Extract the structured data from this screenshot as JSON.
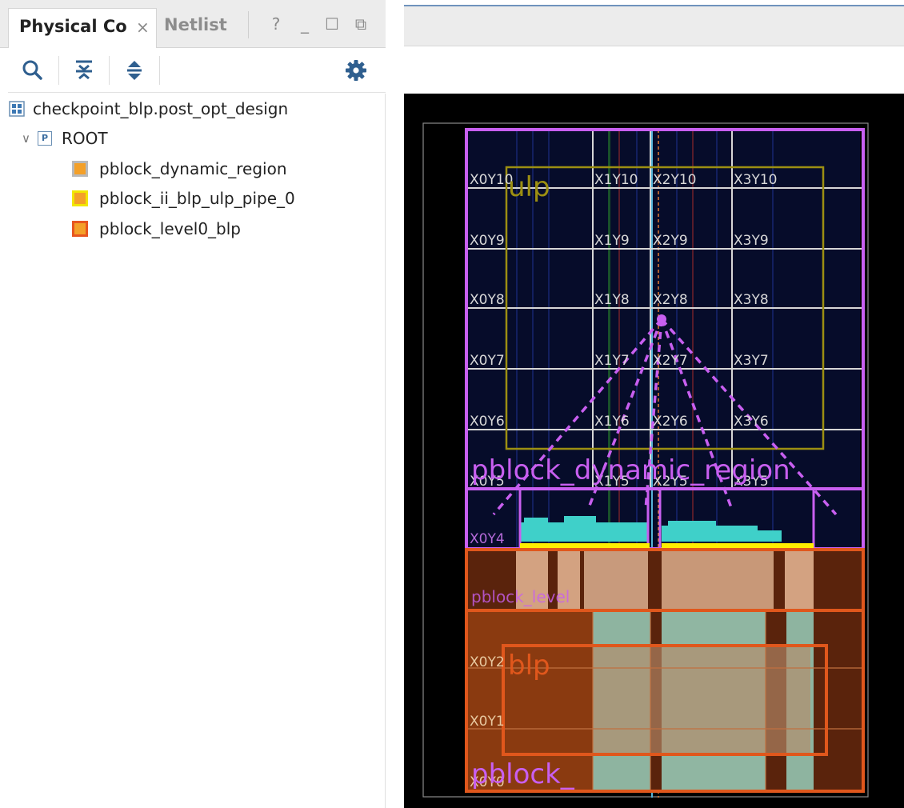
{
  "tabs": {
    "physical_constraints": "Physical Co",
    "netlist": "Netlist",
    "close_symbol": "×"
  },
  "window_controls": {
    "help": "?",
    "minimize": "_",
    "maximize": "☐",
    "float": "⧉"
  },
  "toolbar": {
    "icons": [
      "search-icon",
      "collapse-all-icon",
      "expand-all-icon",
      "settings-gear-icon"
    ]
  },
  "tree": {
    "design": "checkpoint_blp.post_opt_design",
    "root_label": "ROOT",
    "root_badge": "P",
    "expand_symbol": "∨",
    "pblocks": [
      {
        "label": "pblock_dynamic_region",
        "border": "#b9b9b9",
        "fill": "#f4a028"
      },
      {
        "label": "pblock_ii_blp_ulp_pipe_0",
        "border": "#f2e600",
        "fill": "#f4a028"
      },
      {
        "label": "pblock_level0_blp",
        "border": "#e7561f",
        "fill": "#f4a028"
      }
    ]
  },
  "device_view": {
    "clock_regions": {
      "row10": [
        "X0Y10",
        "X1Y10",
        "X2Y10",
        "X3Y10"
      ],
      "row9": [
        "X0Y9",
        "X1Y9",
        "X2Y9",
        "X3Y9"
      ],
      "row8": [
        "X0Y8",
        "X1Y8",
        "X2Y8",
        "X3Y8"
      ],
      "row7": [
        "X0Y7",
        "X1Y7",
        "X2Y7",
        "X3Y7"
      ],
      "row6": [
        "X0Y6",
        "X1Y6",
        "X2Y6",
        "X3Y6"
      ],
      "row5": [
        "X0Y5",
        "X1Y5",
        "X2Y5",
        "X3Y5"
      ],
      "row4": [
        "X0Y4"
      ],
      "lower": [
        "X0Y2",
        "X0Y1",
        "X0Y0"
      ]
    },
    "labels": {
      "ulp": "ulp",
      "dynamic_region": "pblock_dynamic_region",
      "level0_partial": "pblock_level",
      "blp": "blp",
      "pblock_partial": "pblock_"
    },
    "colors": {
      "dynamic_region": "#c85ff0",
      "ulp": "#9c8f12",
      "level0": "#e0571c",
      "pipe": "#ffee00",
      "cells": "#3fd0c9",
      "grid": "#d6d6d6"
    }
  }
}
